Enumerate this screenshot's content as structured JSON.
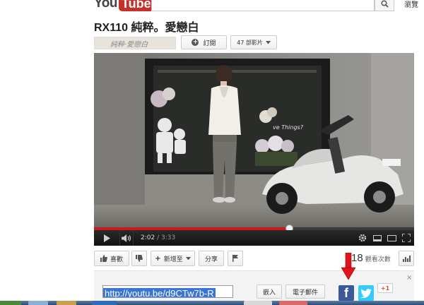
{
  "header": {
    "logo_you": "You",
    "logo_tube": "Tube",
    "search_placeholder": "",
    "browse_label": "瀏覽"
  },
  "video": {
    "title": "RX110 純粹。愛戀白",
    "channel_name": "純粹‧愛戀白",
    "subscribe_label": "訂閱",
    "video_count_label": "47 部影片",
    "played_fraction": 0.61,
    "buffered_fraction": 0.56,
    "current_time": "2:02",
    "duration": "3:33"
  },
  "actions": {
    "like_label": "喜歡",
    "add_to_label": "新增至",
    "share_label": "分享",
    "views_count": "18",
    "views_label": "觀看次數"
  },
  "share": {
    "url": "http://youtu.be/d9CTw7b-R",
    "embed_label": "嵌入",
    "email_label": "電子郵件",
    "gplus_label": "+1",
    "close_glyph": "×"
  },
  "colors": {
    "accent_red": "#cc181e",
    "facebook_blue": "#3b5998",
    "twitter_blue": "#33ccff",
    "selection_blue": "#3875d7"
  },
  "icons": {
    "search": "search-icon",
    "play": "play-icon",
    "volume": "volume-icon",
    "settings": "gear-icon",
    "fullscreen": "fullscreen-icon",
    "like": "thumbs-up-icon",
    "dislike": "thumbs-down-icon",
    "flag": "flag-icon",
    "stats": "stats-icon",
    "facebook": "facebook-icon",
    "twitter": "twitter-icon",
    "annotation": "red-arrow-icon"
  }
}
